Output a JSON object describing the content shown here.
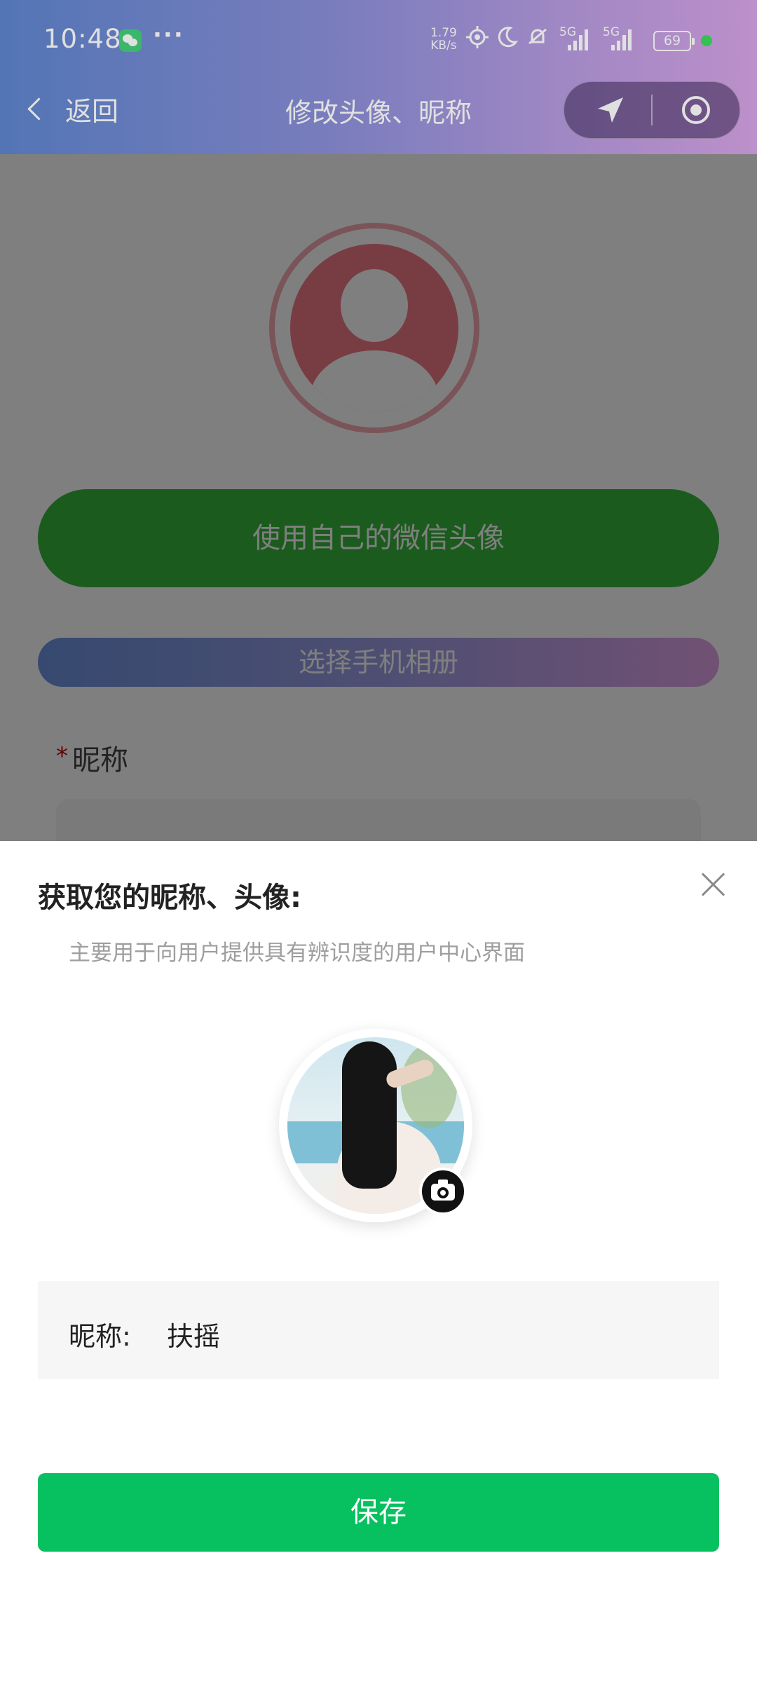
{
  "status_bar": {
    "time": "10:48",
    "more_dots": "···",
    "net_speed_value": "1.79",
    "net_speed_unit": "KB/s",
    "sim1_label": "5G",
    "sim2_label": "5G",
    "battery": "69"
  },
  "nav": {
    "back_label": "返回",
    "title": "修改头像、昵称"
  },
  "background_page": {
    "use_wechat_avatar_label": "使用自己的微信头像",
    "choose_album_label": "选择手机相册",
    "required_mark": "*",
    "nickname_label": "昵称"
  },
  "sheet": {
    "title": "获取您的昵称、头像:",
    "subtitle": "主要用于向用户提供具有辨识度的用户中心界面",
    "nickname_label": "昵称:",
    "nickname_value": "扶摇",
    "save_label": "保存"
  },
  "colors": {
    "primary_green": "#07c160",
    "wechat_green": "#36b63a",
    "header_gradient_start": "#5f86cf",
    "header_gradient_end": "#d7a4e6",
    "avatar_placeholder_pink": "#f07b86",
    "required_red": "#c40000"
  },
  "icons": {
    "back": "chevron-left-icon",
    "location": "navigation-arrow-icon",
    "target": "target-icon",
    "close": "close-icon",
    "camera": "camera-icon"
  }
}
